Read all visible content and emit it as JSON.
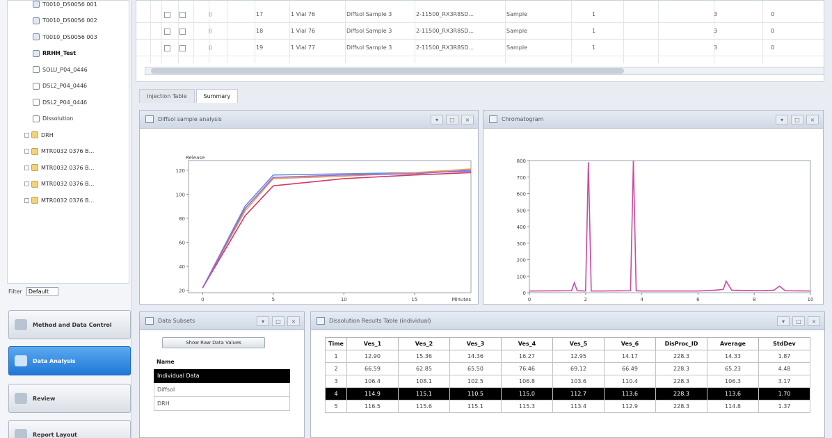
{
  "sidebar": {
    "tree": [
      {
        "label": "T0010_DS0056 001",
        "icon": "dataset-icon",
        "depth": 1
      },
      {
        "label": "T0010_DS0056 002",
        "icon": "dataset-icon",
        "depth": 1
      },
      {
        "label": "T0010_DS0056 003",
        "icon": "dataset-icon",
        "depth": 1
      },
      {
        "label": "RRHH_Test",
        "icon": "dataset-icon",
        "depth": 1,
        "bold": true
      },
      {
        "label": "SOLU_P04_0446",
        "icon": "document-icon",
        "depth": 1
      },
      {
        "label": "DSL2_P04_0446",
        "icon": "document-icon",
        "depth": 1
      },
      {
        "label": "DSL2_P04_0446",
        "icon": "document-icon",
        "depth": 1
      },
      {
        "label": "Dissolution",
        "icon": "document-icon",
        "depth": 1
      },
      {
        "label": "DRH",
        "icon": "folder-icon",
        "depth": 0
      },
      {
        "label": "MTR0032 0376 B...",
        "icon": "folder-icon",
        "depth": 0
      },
      {
        "label": "MTR0032 0376 B...",
        "icon": "folder-icon",
        "depth": 0
      },
      {
        "label": "MTR0032 0376 B...",
        "icon": "folder-icon",
        "depth": 0
      },
      {
        "label": "MTR0032 0376 B...",
        "icon": "folder-icon",
        "depth": 0
      }
    ],
    "filter_label": "Filter",
    "filter_value": "Default",
    "nav": [
      {
        "label": "Method and Data Control",
        "icon": "method-icon",
        "active": false
      },
      {
        "label": "Data Analysis",
        "icon": "analysis-icon",
        "active": true
      },
      {
        "label": "Review",
        "icon": "review-icon",
        "active": false
      },
      {
        "label": "Report Layout",
        "icon": "report-icon",
        "active": false
      }
    ]
  },
  "top_table": {
    "rows": [
      [
        "17",
        "1 Vial 76",
        "Diffsol Sample 3",
        "2-11500_RX3R8SD...",
        "Sample",
        "1",
        "3",
        "0"
      ],
      [
        "18",
        "1 Vial 76",
        "Diffsol Sample 3",
        "2-11500_RX3R8SD...",
        "Sample",
        "1",
        "3",
        "0"
      ],
      [
        "19",
        "1 Vial 77",
        "Diffsol Sample 3",
        "2-11500_RX3R8SD...",
        "Sample",
        "1",
        "3",
        "0"
      ]
    ]
  },
  "tabs": [
    {
      "label": "Injection Table",
      "active": false
    },
    {
      "label": "Summary",
      "active": true
    }
  ],
  "panels": {
    "dissolution_title": "Diffsol sample analysis",
    "chromatogram_title": "Chromatogram",
    "subsets_title": "Data Subsets",
    "summary_title": "Dissolution Results Table (individual)"
  },
  "chart_data": [
    {
      "type": "line",
      "title": "Diffsol sample analysis",
      "ylabel": "Release",
      "xlabel": "Minutes",
      "x_ticks": [
        "0",
        "5",
        "10",
        "15"
      ],
      "y_ticks": [
        "20",
        "40",
        "60",
        "80",
        "100",
        "120"
      ],
      "xlim": [
        -1,
        19
      ],
      "ylim": [
        18,
        128
      ],
      "series": [
        {
          "color": "#6a8ed8",
          "x": [
            0,
            3,
            5,
            10,
            15,
            19
          ],
          "y": [
            22,
            90,
            116,
            117,
            118,
            119
          ]
        },
        {
          "color": "#e3a050",
          "x": [
            0,
            3,
            5,
            10,
            15,
            19
          ],
          "y": [
            22,
            86,
            113,
            115,
            118,
            121
          ]
        },
        {
          "color": "#d43a6a",
          "x": [
            0,
            3,
            5,
            10,
            15,
            19
          ],
          "y": [
            22,
            82,
            107,
            113,
            116,
            118
          ]
        },
        {
          "color": "#9a6ad0",
          "x": [
            0,
            3,
            5,
            10,
            15,
            19
          ],
          "y": [
            22,
            88,
            114,
            116,
            117,
            120
          ]
        }
      ]
    },
    {
      "type": "line",
      "title": "Chromatogram",
      "x_ticks": [
        "0",
        "2",
        "4",
        "6",
        "8",
        "10"
      ],
      "y_ticks": [
        "0",
        "100",
        "200",
        "300",
        "400",
        "500",
        "600",
        "700",
        "800"
      ],
      "xlim": [
        0,
        10
      ],
      "ylim": [
        0,
        800
      ],
      "series": [
        {
          "color": "#cc4aa0",
          "x": [
            0,
            1.5,
            1.6,
            1.7,
            2.0,
            2.1,
            2.2,
            2.5,
            3.6,
            3.7,
            3.8,
            4.0,
            6.0,
            6.6,
            6.9,
            7.0,
            7.2,
            8.2,
            8.7,
            8.9,
            9.1,
            10
          ],
          "y": [
            10,
            12,
            60,
            12,
            10,
            790,
            10,
            10,
            12,
            800,
            12,
            10,
            10,
            15,
            20,
            70,
            15,
            12,
            15,
            40,
            12,
            10
          ]
        }
      ]
    }
  ],
  "subsets": {
    "button_label": "Show Raw Data Values",
    "header": "Name",
    "items": [
      {
        "label": "Individual Data",
        "selected": true
      },
      {
        "label": "Diffsol",
        "selected": false
      },
      {
        "label": "DRH",
        "selected": false
      }
    ]
  },
  "summary_table": {
    "columns": [
      "Time",
      "Ves_1",
      "Ves_2",
      "Ves_3",
      "Ves_4",
      "Ves_5",
      "Ves_6",
      "DisProc_ID",
      "Average",
      "StdDev"
    ],
    "rows": [
      [
        "1",
        "12.90",
        "15.36",
        "14.36",
        "16.27",
        "12.95",
        "14.17",
        "228.3",
        "14.33",
        "1.87"
      ],
      [
        "2",
        "66.59",
        "62.85",
        "65.50",
        "76.46",
        "69.12",
        "66.49",
        "228.3",
        "65.23",
        "4.48"
      ],
      [
        "3",
        "106.4",
        "108.1",
        "102.5",
        "106.8",
        "103.6",
        "110.4",
        "228.3",
        "106.3",
        "3.17"
      ],
      [
        "4",
        "114.9",
        "115.1",
        "110.5",
        "115.0",
        "112.7",
        "113.6",
        "228.3",
        "113.6",
        "1.70"
      ],
      [
        "5",
        "116.5",
        "115.6",
        "115.1",
        "115.3",
        "113.4",
        "112.9",
        "228.3",
        "114.8",
        "1.37"
      ]
    ],
    "selected_row": 3
  }
}
